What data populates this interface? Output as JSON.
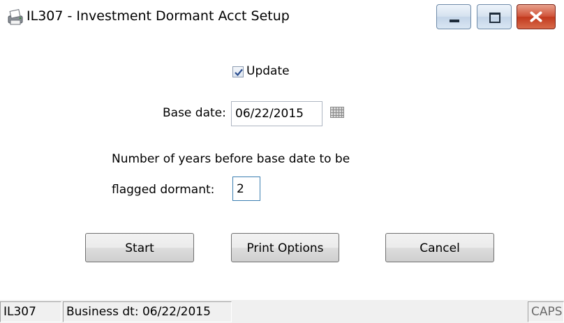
{
  "window": {
    "title": "IL307 - Investment Dormant Acct Setup",
    "icon": "printer-icon",
    "controls": [
      "minimize",
      "maximize",
      "close"
    ]
  },
  "form": {
    "update_checked": true,
    "update_label": "Update",
    "base_date_label": "Base date:",
    "base_date_value": "06/22/2015",
    "years_label_line1": "Number of years before base date to be",
    "years_label_line2": "flagged dormant:",
    "years_value": "2"
  },
  "buttons": {
    "start": "Start",
    "print_options": "Print Options",
    "cancel": "Cancel"
  },
  "status": {
    "program": "IL307",
    "business_date": "Business dt: 06/22/2015",
    "caps": "CAPS"
  },
  "colors": {
    "close_button": "#c23a1e",
    "window_bg": "#ffffff",
    "status_bg": "#f0f0f0"
  }
}
